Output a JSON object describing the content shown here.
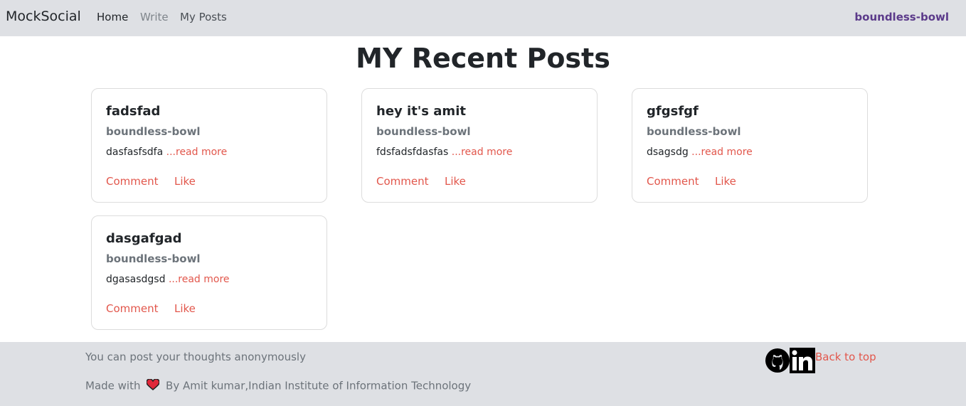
{
  "nav": {
    "brand": "MockSocial",
    "home": "Home",
    "write": "Write",
    "my_posts": "My Posts",
    "user": "boundless-bowl"
  },
  "page_title": "MY Recent Posts",
  "posts": [
    {
      "title": "fadsfad",
      "author": "boundless-bowl",
      "excerpt": "dasfasfsdfa",
      "read_more": "...read more",
      "comment": "Comment",
      "like": "Like"
    },
    {
      "title": "hey it's amit",
      "author": "boundless-bowl",
      "excerpt": "fdsfadsfdasfas",
      "read_more": "...read more",
      "comment": "Comment",
      "like": "Like"
    },
    {
      "title": "gfgsfgf",
      "author": "boundless-bowl",
      "excerpt": "dsagsdg",
      "read_more": "...read more",
      "comment": "Comment",
      "like": "Like"
    },
    {
      "title": "dasgafgad",
      "author": "boundless-bowl",
      "excerpt": "dgasasdgsd",
      "read_more": "...read more",
      "comment": "Comment",
      "like": "Like"
    }
  ],
  "footer": {
    "line1": "You can post your thoughts anonymously",
    "made_with": "Made with",
    "by_line": "By Amit kumar,Indian Institute of Information Technology",
    "back_to_top": "Back to top",
    "icons": [
      "heart-icon",
      "github-icon",
      "linkedin-icon"
    ]
  },
  "colors": {
    "accent": "#e2574c",
    "nav_bg": "#dee0e4",
    "user": "#5b3a8a"
  }
}
